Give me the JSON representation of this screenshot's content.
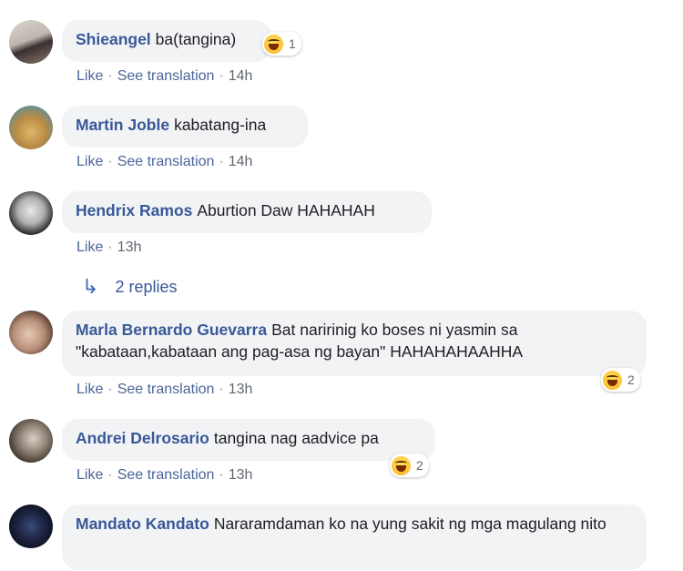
{
  "comments": [
    {
      "author": "Shieangel",
      "text": "ba(tangina)",
      "actions": [
        "Like",
        "See translation"
      ],
      "time": "14h",
      "reaction_count": "1"
    },
    {
      "author": "Martin Joble",
      "text": "kabatang-ina",
      "actions": [
        "Like",
        "See translation"
      ],
      "time": "14h"
    },
    {
      "author": "Hendrix Ramos",
      "text": "Aburtion Daw HAHAHAH",
      "actions": [
        "Like"
      ],
      "time": "13h",
      "replies": "2 replies"
    },
    {
      "author": "Marla Bernardo Guevarra",
      "text": "Bat naririnig ko boses ni yasmin sa \"kabataan,kabataan ang pag-asa ng bayan\" HAHAHAHAAHHA",
      "actions": [
        "Like",
        "See translation"
      ],
      "time": "13h",
      "reaction_count": "2"
    },
    {
      "author": "Andrei Delrosario",
      "text": "tangina nag aadvice pa",
      "actions": [
        "Like",
        "See translation"
      ],
      "time": "13h",
      "reaction_count": "2"
    },
    {
      "author": "Mandato Kandato",
      "text": "Nararamdaman ko na yung sakit ng mga magulang nito"
    }
  ],
  "icons": {
    "reaction": "haha-emoji-icon",
    "reply_arrow": "reply-arrow-icon"
  },
  "colors": {
    "author": "#385898",
    "bubble": "#f2f3f5",
    "link": "#4b6599"
  }
}
